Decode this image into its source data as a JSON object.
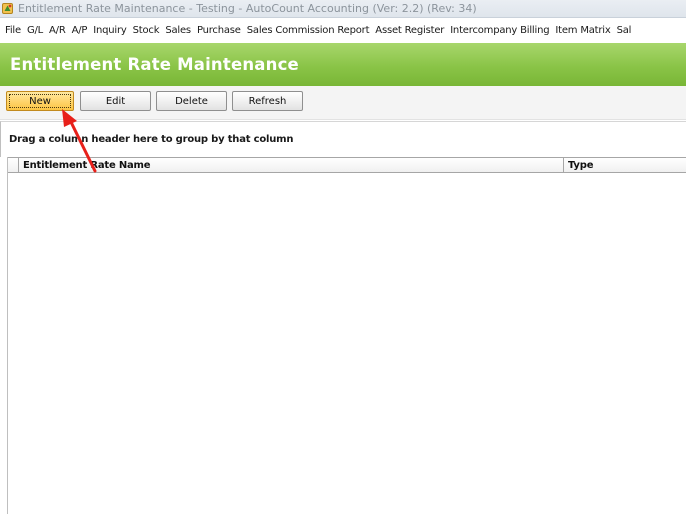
{
  "window": {
    "title": "Entitlement Rate Maintenance - Testing - AutoCount Accounting (Ver: 2.2) (Rev: 34)",
    "app_icon": "autocount-app-icon"
  },
  "menu": {
    "items": [
      {
        "label": "File"
      },
      {
        "label": "G/L"
      },
      {
        "label": "A/R"
      },
      {
        "label": "A/P"
      },
      {
        "label": "Inquiry"
      },
      {
        "label": "Stock"
      },
      {
        "label": "Sales"
      },
      {
        "label": "Purchase"
      },
      {
        "label": "Sales Commission Report"
      },
      {
        "label": "Asset Register"
      },
      {
        "label": "Intercompany Billing"
      },
      {
        "label": "Item Matrix"
      },
      {
        "label": "Sal"
      }
    ]
  },
  "header": {
    "title": "Entitlement Rate Maintenance",
    "accent_color": "#8ac447"
  },
  "toolbar": {
    "new_label": "New",
    "edit_label": "Edit",
    "delete_label": "Delete",
    "refresh_label": "Refresh",
    "active_button": "new"
  },
  "grid": {
    "group_hint": "Drag a column header here to group by that column",
    "columns": [
      {
        "label": "Entitlement Rate Name"
      },
      {
        "label": "Type"
      }
    ],
    "rows": []
  },
  "annotation": {
    "type": "arrow",
    "color": "#e8201a",
    "points_to": "new-button"
  }
}
